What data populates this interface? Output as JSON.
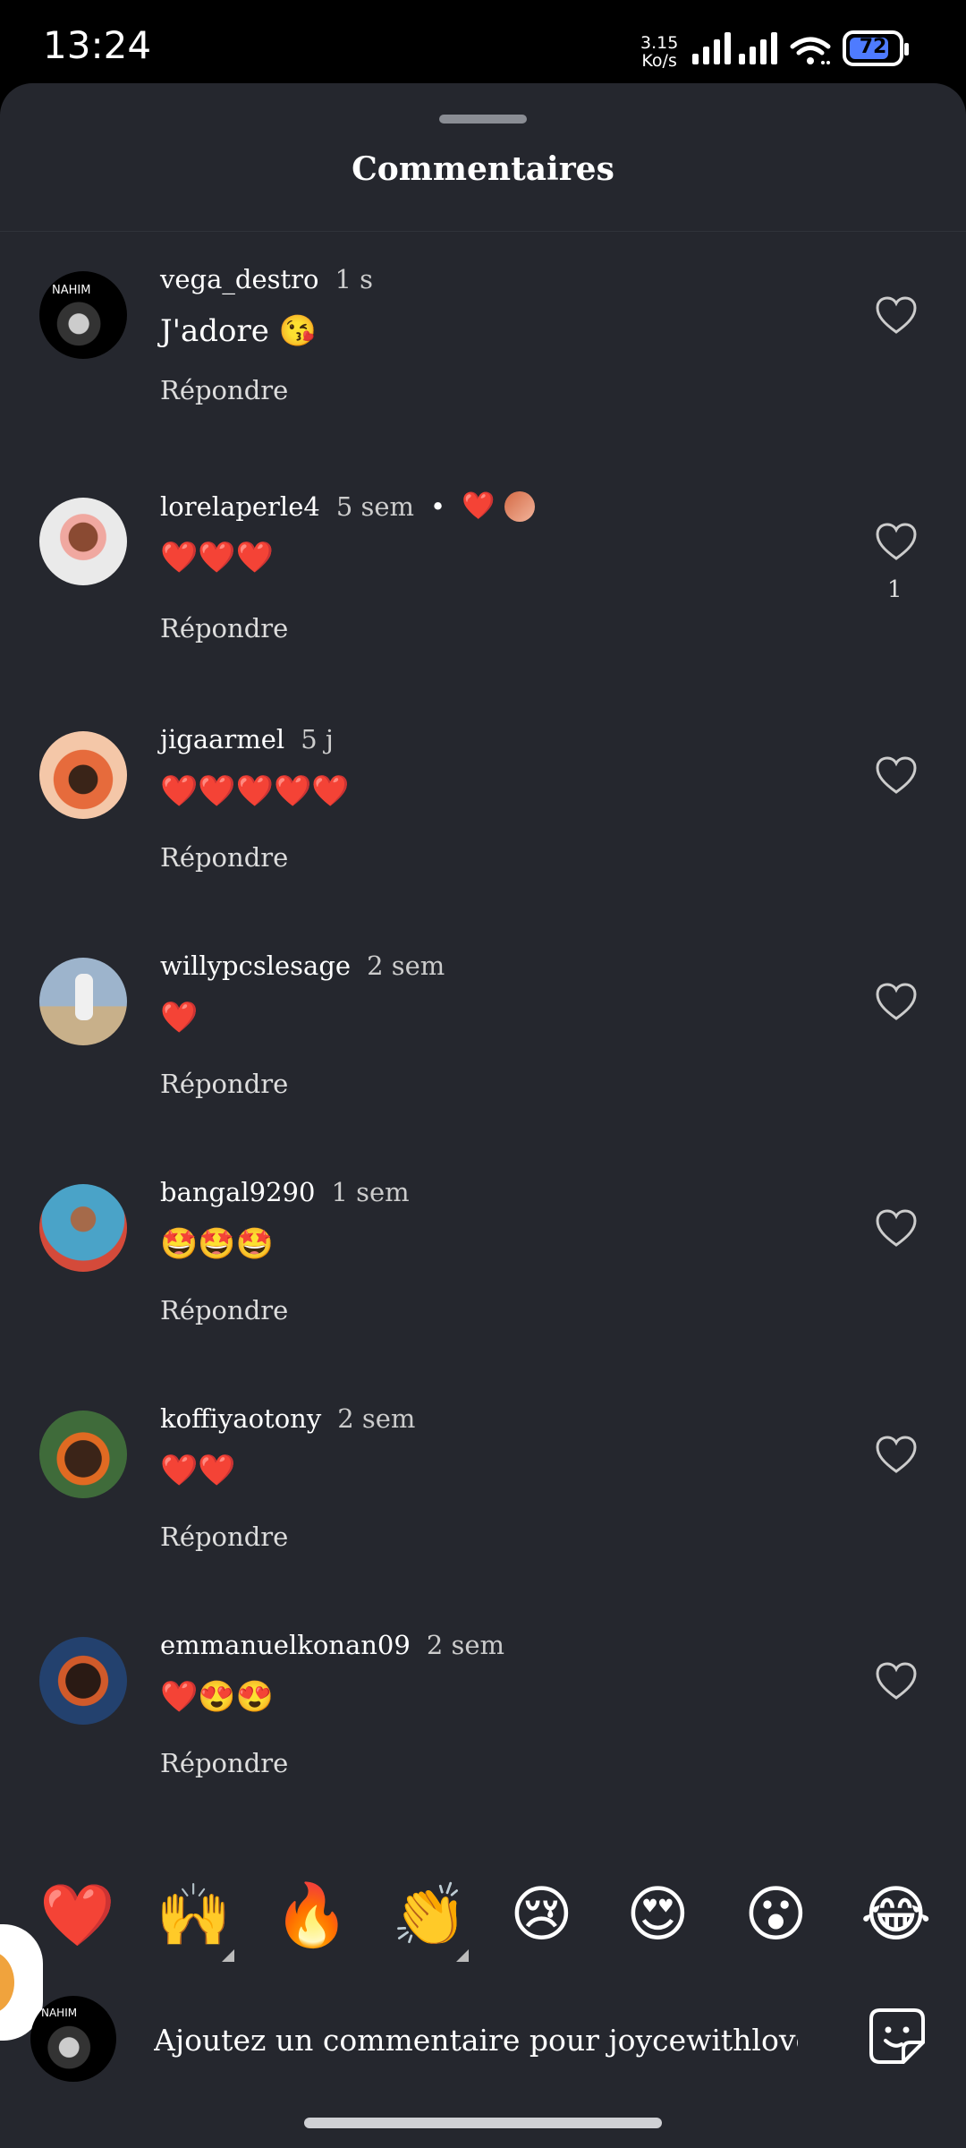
{
  "status": {
    "time": "13:24",
    "net_speed_value": "3.15",
    "net_speed_unit": "Ko/s",
    "battery": "72"
  },
  "sheet": {
    "title": "Commentaires"
  },
  "reply_label": "Répondre",
  "comments": [
    {
      "username": "vega_destro",
      "ago": "1 s",
      "text": "J'adore 😘",
      "likes": ""
    },
    {
      "username": "lorelaperle4",
      "ago": "5 sem",
      "text": "❤️❤️❤️",
      "likes": "1",
      "bullet": "•",
      "reaction": "❤️"
    },
    {
      "username": "jigaarmel",
      "ago": "5 j",
      "text": "❤️❤️❤️❤️❤️",
      "likes": ""
    },
    {
      "username": "willypcslesage",
      "ago": "2 sem",
      "text": "❤️",
      "likes": ""
    },
    {
      "username": "bangal9290",
      "ago": "1 sem",
      "text": "🤩🤩🤩",
      "likes": ""
    },
    {
      "username": "koffiyaotony",
      "ago": "2 sem",
      "text": "❤️❤️",
      "likes": ""
    },
    {
      "username": "emmanuelkonan09",
      "ago": "2 sem",
      "text": "❤️😍😍",
      "likes": ""
    }
  ],
  "avatar_labels": {
    "vega": "NAHIM"
  },
  "emoji_bar": [
    "❤️",
    "🙌",
    "🔥",
    "👏",
    "😢",
    "😍",
    "😮",
    "😂"
  ],
  "composer": {
    "placeholder": "Ajoutez un commentaire pour joycewithlove_..."
  },
  "colors": {
    "sheet_bg": "#25272e",
    "like_icon": "#cccccc"
  }
}
